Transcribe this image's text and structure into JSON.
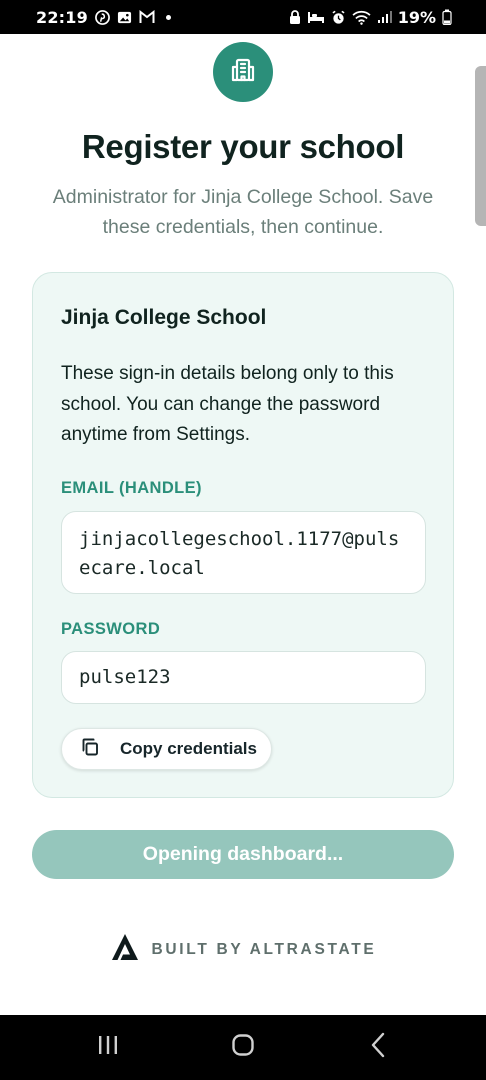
{
  "status_bar": {
    "time": "22:19",
    "battery": "19%",
    "left_icons": [
      "pinterest-icon",
      "gallery-icon",
      "gmail-icon"
    ],
    "right_icons": [
      "lock-icon",
      "sleep-icon",
      "alarm-icon",
      "wifi-icon",
      "signal-icon",
      "battery-icon"
    ]
  },
  "header": {
    "logo_icon": "school-building-icon",
    "title": "Register your school",
    "subtitle": "Administrator for Jinja College School. Save these credentials, then continue."
  },
  "card": {
    "school_name": "Jinja College School",
    "description": "These sign-in details belong only to this school. You can change the password anytime from Settings.",
    "email_label": "EMAIL (HANDLE)",
    "email_value": "jinjacollegeschool.1177@pulsecare.local",
    "password_label": "PASSWORD",
    "password_value": "pulse123",
    "copy_button_label": "Copy credentials",
    "copy_icon": "copy-icon"
  },
  "primary_button": {
    "label": "Opening dashboard..."
  },
  "footer": {
    "brand_icon": "altrastate-logo-icon",
    "brand_text": "BUILT BY ALTRASTATE"
  },
  "navigation": {
    "buttons": [
      "recent-apps-icon",
      "home-icon",
      "back-icon"
    ]
  },
  "colors": {
    "accent": "#2b8f7a",
    "card_background": "#eef8f5",
    "button_disabled": "#95c6bc",
    "title": "#10231f",
    "subtitle": "#6b7f7a"
  }
}
